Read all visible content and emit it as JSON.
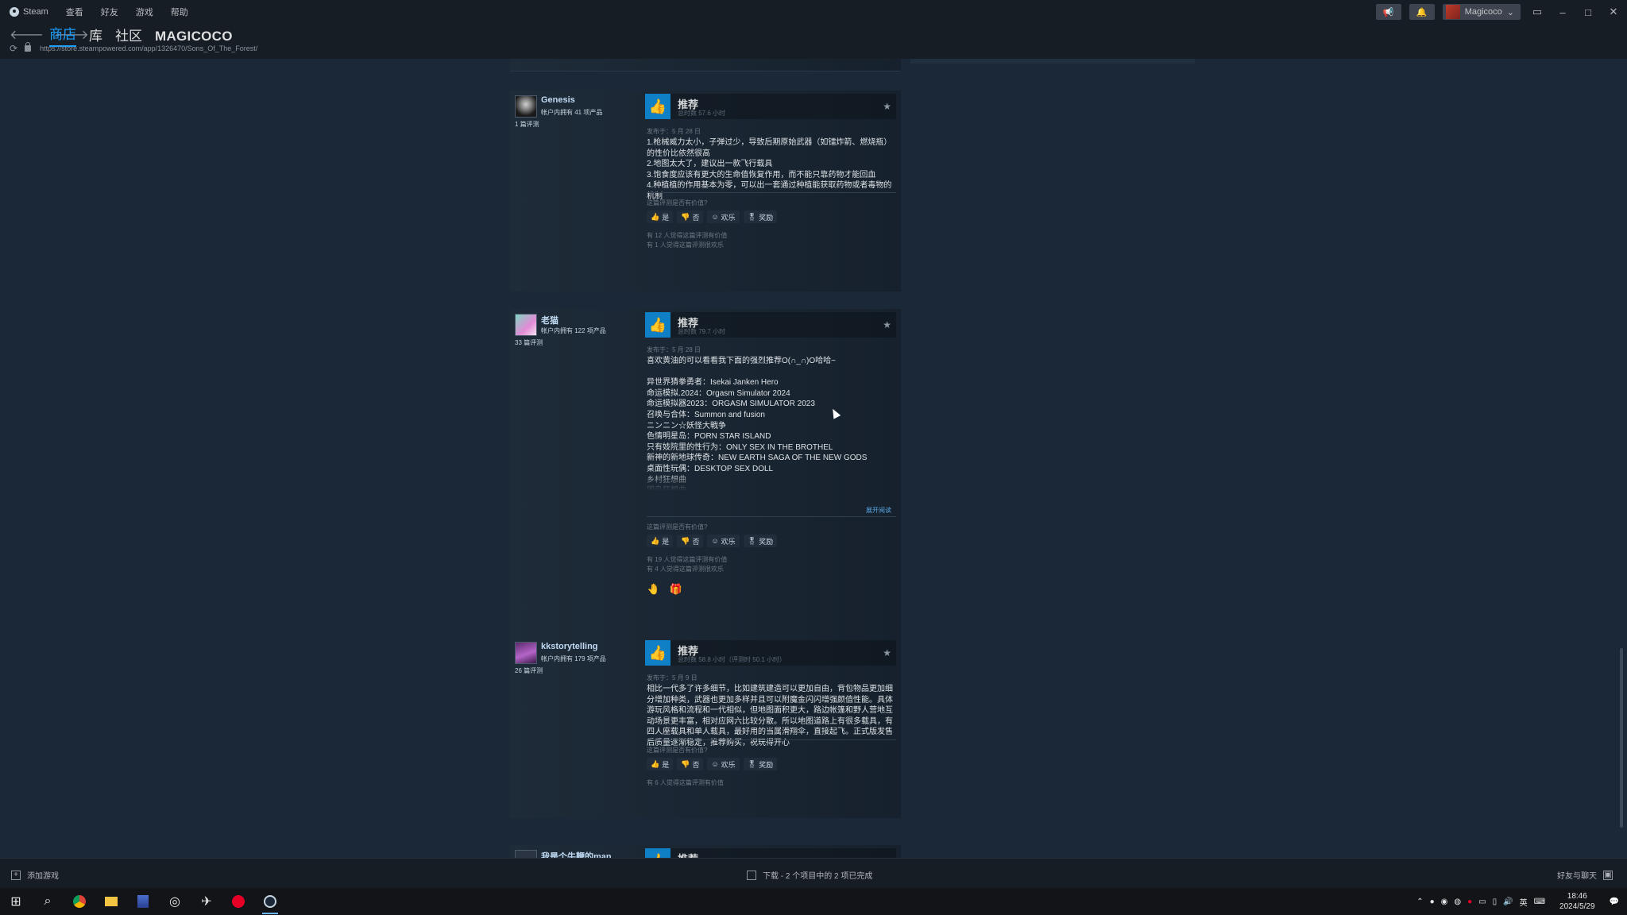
{
  "titlebar": {
    "menu": [
      "Steam",
      "查看",
      "好友",
      "游戏",
      "帮助"
    ],
    "user_name": "Magicoco",
    "icons": [
      "megaphone-icon",
      "bell-icon",
      "monitor-icon",
      "minimize-icon",
      "maximize-icon",
      "close-icon"
    ]
  },
  "nav": {
    "tabs": [
      "商店",
      "库",
      "社区",
      "MAGICOCO"
    ],
    "active_tab": "商店",
    "url": "https://store.steampowered.com/app/1326470/Sons_Of_The_Forest/"
  },
  "reviews": [
    {
      "author": "Genesis",
      "owned": "帐户内拥有 41 项产品",
      "review_count": "1 篇评测",
      "verdict": "推荐",
      "hours": "总时数 57.6 小时",
      "posted": "发布于：5 月 28 日",
      "text": "1.枪械威力太小，子弹过少，导致后期原始武器（如镭炸箭、燃烧瓶）的性价比依然很高\n2.地图太大了，建议出一款飞行载具\n3.饱食度应该有更大的生命值恢复作用，而不能只靠药物才能回血\n4.种植植的作用基本为零，可以出一套通过种植能获取药物或者毒物的机制",
      "helpful_question": "这篇评测是否有价值?",
      "buttons": [
        "是",
        "否",
        "欢乐",
        "奖励"
      ],
      "stats": [
        "有 12 人觉得这篇评测有价值",
        "有 1 人觉得这篇评测很欢乐"
      ],
      "avatar_colors": [
        "#1a1a1a",
        "#cfcfcf"
      ]
    },
    {
      "author": "老猫",
      "owned": "帐户内拥有 122 项产品",
      "review_count": "33 篇评测",
      "verdict": "推荐",
      "hours": "总时数 79.7 小时",
      "posted": "发布于：5 月 28 日",
      "text": "喜欢黄油的可以看看我下面的强烈推荐O(∩_∩)O哈哈~\n\n异世界猜拳勇者：Isekai Janken Hero\n命运模拟.2024：Orgasm Simulator 2024\n命运模拟器2023：ORGASM SIMULATOR 2023\n召唤与合体：Summon and fusion\nニンニン☆妖怪大戦争\n色情明星岛：PORN STAR ISLAND\n只有妓院里的性行为：ONLY SEX IN THE BROTHEL\n新神的新地球传奇：NEW EARTH SAGA OF THE NEW GODS\n桌面性玩偶：DESKTOP SEX DOLL\n乡村狂想曲\n即岛狂想曲",
      "read_more": "展开阅读",
      "helpful_question": "这篇评测是否有价值?",
      "buttons": [
        "是",
        "否",
        "欢乐",
        "奖励"
      ],
      "stats": [
        "有 19 人觉得这篇评测有价值",
        "有 4 人觉得这篇评测很欢乐"
      ],
      "award_badges": [
        "hand-award-icon",
        "gift-award-icon"
      ],
      "avatar_colors": [
        "#7fd6c2",
        "#e38bd6"
      ]
    },
    {
      "author": "kkstorytelling",
      "owned": "帐户内拥有 179 项产品",
      "review_count": "26 篇评测",
      "verdict": "推荐",
      "hours": "总时数 58.8 小时（评测时 50.1 小时）",
      "posted": "发布于：5 月 9 日",
      "text": "相比一代多了许多细节，比如建筑建造可以更加自由，背包物品更加细分增加种类，武器也更加多样并且可以附魔金闪闪增强颜值性能。具体游玩风格和流程和一代相似，但地图面积更大，路边帐篷和野人营地互动场景更丰富，相对应网六比较分散。所以地图道路上有很多载具，有四人座载具和单人载具，最好用的当属滑翔伞，直接起飞。正式版发售后质量逐渐稳定，推荐购买，祝玩得开心",
      "helpful_question": "这篇评测是否有价值?",
      "buttons": [
        "是",
        "否",
        "欢乐",
        "奖励"
      ],
      "stats": [
        "有 6 人觉得这篇评测有价值"
      ],
      "avatar_colors": [
        "#5a2a6a",
        "#b565c9"
      ]
    },
    {
      "author": "我是个牛鞭的man",
      "verdict": "推荐"
    }
  ],
  "bottombar": {
    "add_game": "添加游戏",
    "download_status": "下载 - 2 个项目中的 2 项已完成",
    "friends_chat": "好友与聊天"
  },
  "taskbar": {
    "apps": [
      "windows-start-icon",
      "search-icon",
      "chrome-icon",
      "file-explorer-icon",
      "app-icon",
      "app-icon-2",
      "app-icon-3",
      "netease-music-icon",
      "steam-icon"
    ],
    "ime": "英",
    "time": "18:46",
    "date": "2024/5/29"
  }
}
